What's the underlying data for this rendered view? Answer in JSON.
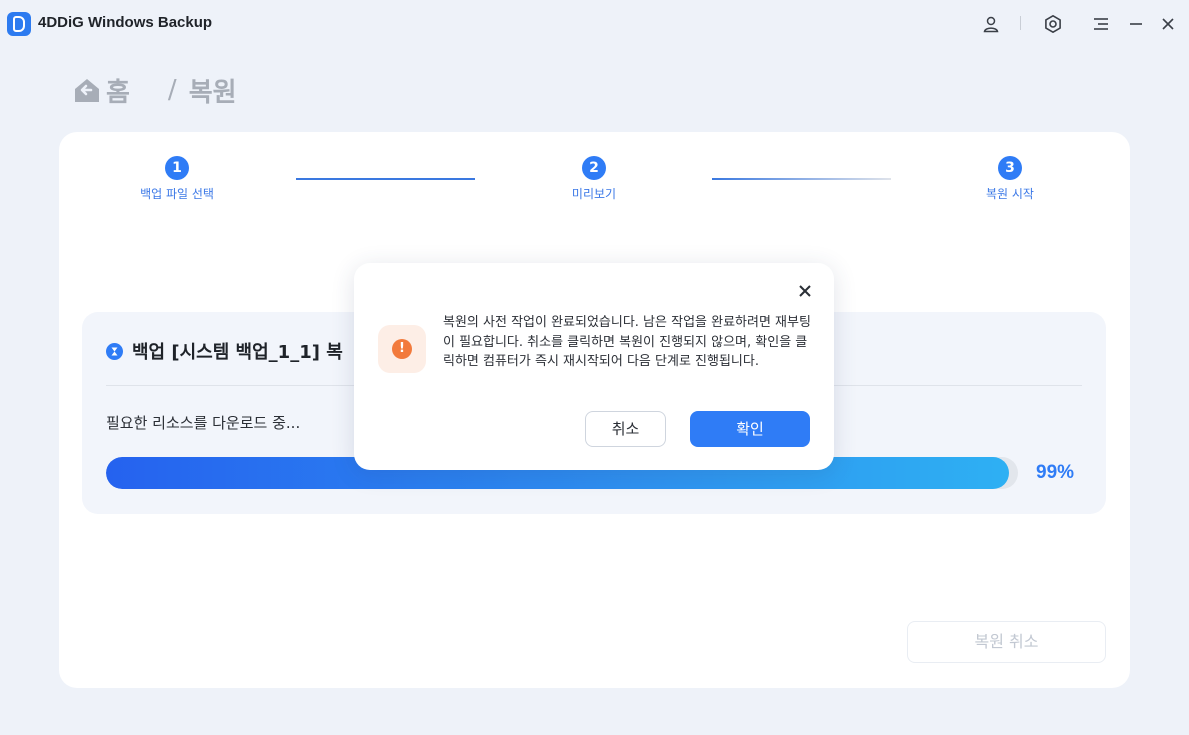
{
  "app": {
    "title": "4DDiG Windows Backup"
  },
  "titlebar": {
    "icons": [
      "user-icon",
      "settings-icon",
      "menu-icon",
      "minimize-icon",
      "close-icon"
    ]
  },
  "breadcrumb": {
    "home": "홈",
    "separator": "/",
    "current": "복원"
  },
  "steps": [
    {
      "number": "1",
      "label": "백업 파일 선택"
    },
    {
      "number": "2",
      "label": "미리보기"
    },
    {
      "number": "3",
      "label": "복원 시작"
    }
  ],
  "progress": {
    "title": "백업 [시스템 백업_1_1] 복",
    "status": "필요한 리소스를 다운로드 중...",
    "percent_label": "99%",
    "value": 0.99
  },
  "restore_cancel_label": "복원 취소",
  "dialog": {
    "message": "복원의 사전 작업이 완료되었습니다. 남은 작업을 완료하려면 재부팅이 필요합니다. 취소를 클릭하면 복원이 진행되지 않으며, 확인을 클릭하면 컴퓨터가 즉시 재시작되어 다음 단계로 진행됩니다.",
    "cancel_label": "취소",
    "ok_label": "확인"
  },
  "colors": {
    "accent": "#2f7cf6",
    "warning": "#f27a3c",
    "background": "#eef2f9"
  }
}
